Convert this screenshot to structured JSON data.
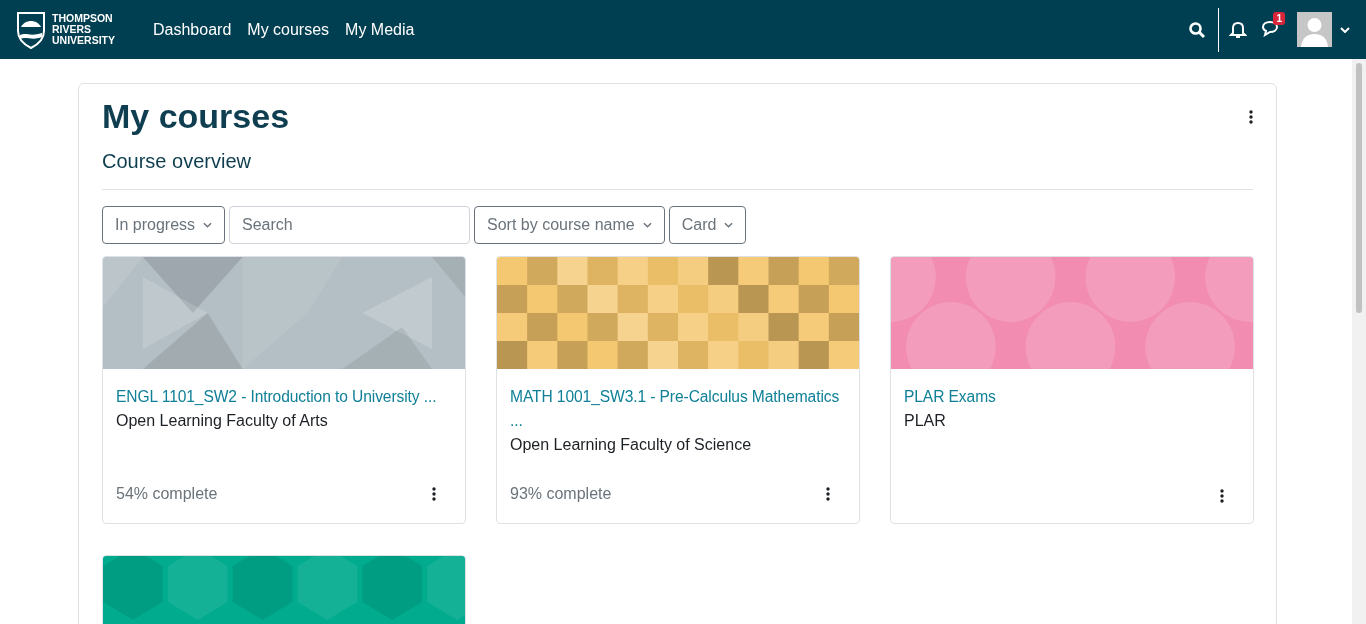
{
  "navbar": {
    "logo_lines": [
      "THOMPSON",
      "RIVERS",
      "UNIVERSITY"
    ],
    "links": [
      "Dashboard",
      "My courses",
      "My Media"
    ],
    "message_badge": "1"
  },
  "page": {
    "title": "My courses",
    "section": "Course overview",
    "filters": [
      {
        "kind": "dropdown",
        "label": "In progress"
      },
      {
        "kind": "search",
        "placeholder": "Search"
      },
      {
        "kind": "dropdown",
        "label": "Sort by course name"
      },
      {
        "kind": "dropdown",
        "label": "Card"
      }
    ],
    "courses": [
      {
        "kind": "triangles",
        "color": "#b4bfc5",
        "title": "ENGL 1101_SW2 - Introduction to University ...",
        "category": "Open Learning Faculty of Arts",
        "progress": "54% complete"
      },
      {
        "kind": "squares",
        "color": "#f4c56c",
        "title": "MATH 1001_SW3.1 - Pre-Calculus Mathematics ...",
        "category": "Open Learning Faculty of Science",
        "progress": "93% complete"
      },
      {
        "kind": "circles",
        "color": "#f28cb1",
        "title": "PLAR Exams",
        "category": "PLAR"
      },
      {
        "kind": "hexagons",
        "color": "#00ab8e"
      }
    ]
  }
}
